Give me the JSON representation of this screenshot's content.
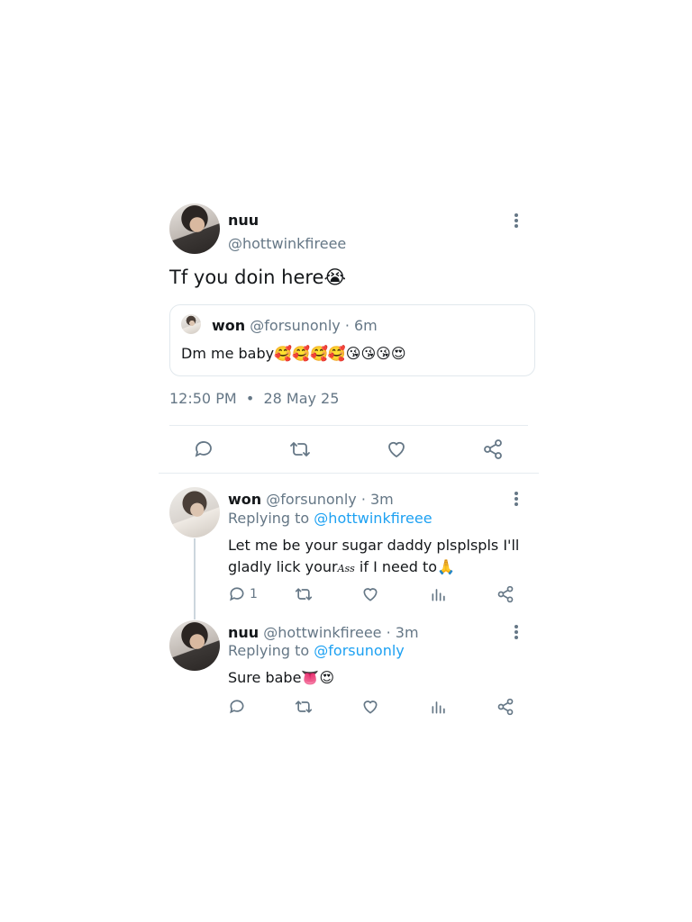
{
  "main_tweet": {
    "name": "nuu",
    "handle": "@hottwinkfireee",
    "text": "Tf you doin here",
    "text_emoji": "😭",
    "quoted": {
      "name": "won",
      "handle_time": "@forsunonly · 6m",
      "text": "Dm me baby",
      "text_emoji": "🥰🥰🥰🥰😘😘😘😍"
    },
    "time": "12:50 PM",
    "dot": "•",
    "date": "28 May 25"
  },
  "replies": [
    {
      "name": "won",
      "handle_time": "@forsunonly · 3m",
      "replying_prefix": "Replying to",
      "replying_handle": "@hottwinkfireee",
      "line1": "Let me be your sugar daddy plsplspls I'll",
      "line2_a": "gladly lick your",
      "line2_styled": "Ass",
      "line2_b": " if I need to",
      "line2_emoji": "🙏",
      "reply_count": "1"
    },
    {
      "name": "nuu",
      "handle_time": "@hottwinkfireee · 3m",
      "replying_prefix": "Replying to",
      "replying_handle": "@forsunonly",
      "text": "Sure babe",
      "text_emoji": "👅😍"
    }
  ],
  "icons": {
    "reply": "reply-icon",
    "retweet": "retweet-icon",
    "like": "heart-icon",
    "share": "share-icon",
    "analytics": "analytics-icon",
    "more": "more-vertical-icon"
  },
  "colors": {
    "link": "#1da1f2",
    "secondary": "#657786",
    "border": "#e1e8ed"
  }
}
